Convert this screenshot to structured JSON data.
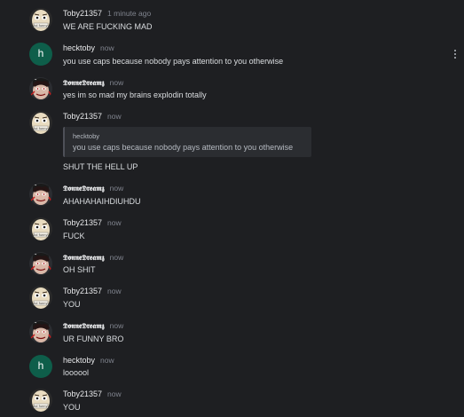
{
  "messages": [
    {
      "author": "Toby21357",
      "time": "1 minute ago",
      "text": "WE ARE FUCKING MAD",
      "avatar": "toby-icon"
    },
    {
      "author": "hecktoby",
      "time": "now",
      "text": "you use caps because nobody pays attention to you otherwise",
      "avatar": "h",
      "avatar_letter": "h"
    },
    {
      "author": "𝕯𝖔𝖓𝖓𝖊𝕯𝖗𝖊𝖆𝖒𝖟",
      "time": "now",
      "text": "yes im so mad my brains explodin totally",
      "avatar": "donne-icon"
    },
    {
      "author": "Toby21357",
      "time": "now",
      "text": "SHUT THE HELL UP",
      "avatar": "toby-icon",
      "reply": {
        "author": "hecktoby",
        "text": "you use caps because nobody pays attention to you otherwise"
      }
    },
    {
      "author": "𝕯𝖔𝖓𝖓𝖊𝕯𝖗𝖊𝖆𝖒𝖟",
      "time": "now",
      "text": "AHAHAHAIHDIUHDU",
      "avatar": "donne-icon"
    },
    {
      "author": "Toby21357",
      "time": "now",
      "text": "FUCK",
      "avatar": "toby-icon"
    },
    {
      "author": "𝕯𝖔𝖓𝖓𝖊𝕯𝖗𝖊𝖆𝖒𝖟",
      "time": "now",
      "text": "OH SHIT",
      "avatar": "donne-icon"
    },
    {
      "author": "Toby21357",
      "time": "now",
      "text": "YOU",
      "avatar": "toby-icon"
    },
    {
      "author": "𝕯𝖔𝖓𝖓𝖊𝕯𝖗𝖊𝖆𝖒𝖟",
      "time": "now",
      "text": "UR FUNNY BRO",
      "avatar": "donne-icon"
    },
    {
      "author": "hecktoby",
      "time": "now",
      "text": "loooool",
      "avatar": "h",
      "avatar_letter": "h"
    },
    {
      "author": "Toby21357",
      "time": "now",
      "text": "YOU",
      "avatar": "toby-icon"
    }
  ],
  "colors": {
    "background": "#1e1f22",
    "hecktoby_avatar": "#0e5e4a",
    "quote_bg": "#2b2d31"
  },
  "icons": {
    "more": "kebab-menu-icon"
  }
}
